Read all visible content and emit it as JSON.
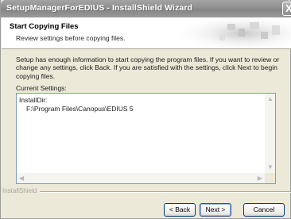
{
  "window": {
    "title": "SetupManagerForEDIUS - InstallShield Wizard",
    "close_glyph": "X"
  },
  "header": {
    "title": "Start Copying Files",
    "subtitle": "Review settings before copying files."
  },
  "body": {
    "description": "Setup has enough information to start copying the program files.  If you want to review or change any settings, click Back.  If you are satisfied with the settings, click Next to begin copying files.",
    "current_settings_label": "Current Settings:"
  },
  "settings": {
    "line1": "InstallDir:",
    "line2": "F:\\Program Files\\Canopus\\EDIUS 5"
  },
  "footer": {
    "brand": "InstallShield",
    "back_label": "< Back",
    "next_label": "Next >",
    "cancel_label": "Cancel"
  }
}
